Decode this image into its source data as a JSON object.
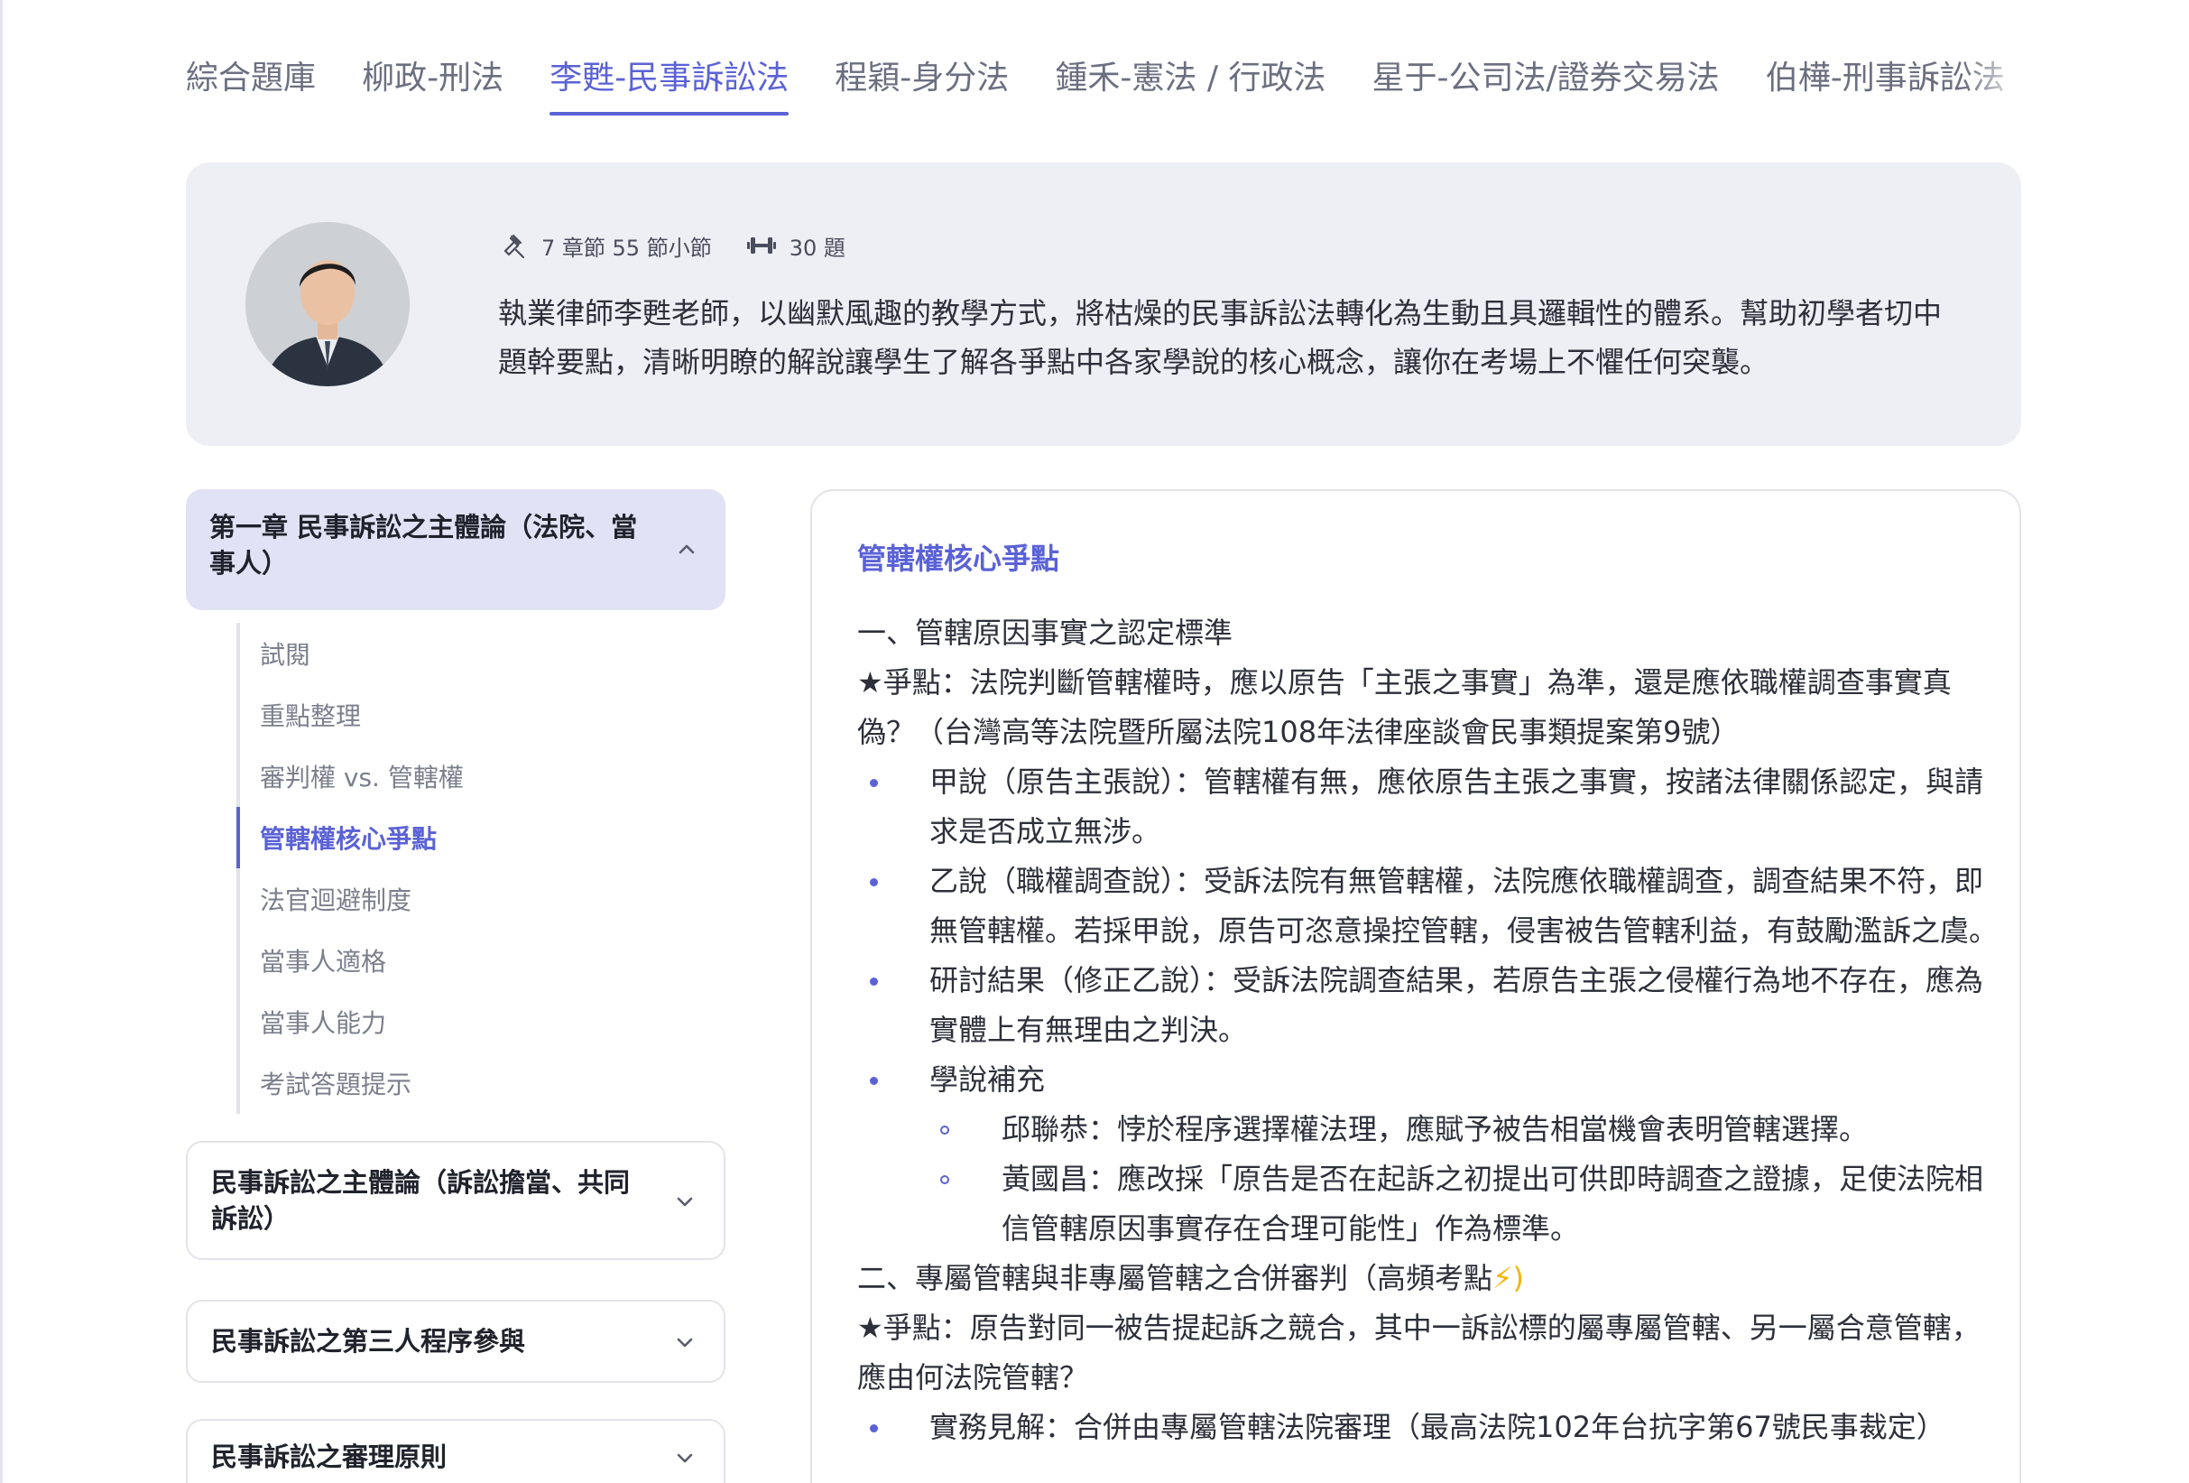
{
  "tabs": [
    {
      "label": "綜合題庫"
    },
    {
      "label": "柳政-刑法"
    },
    {
      "label": "李甦-民事訴訟法"
    },
    {
      "label": "程穎-身分法"
    },
    {
      "label": "鍾禾-憲法 / 行政法"
    },
    {
      "label": "星于-公司法/證券交易法"
    },
    {
      "label": "伯樺-刑事訴訟法"
    }
  ],
  "active_tab_index": 2,
  "course": {
    "chapters_text": "7 章節 55 節小節",
    "questions_text": "30 題",
    "description": "執業律師李甦老師，以幽默風趣的教學方式，將枯燥的民事訴訟法轉化為生動且具邏輯性的體系。幫助初學者切中題幹要點，清晰明瞭的解說讓學生了解各爭點中各家學說的核心概念，讓你在考場上不懼任何突襲。",
    "icons": {
      "chapters": "gavel-icon",
      "questions": "dumbbell-icon"
    }
  },
  "sidebar": {
    "open_chapter": {
      "title": "第一章 民事訴訟之主體論（法院、當事人）",
      "sections": [
        {
          "label": "試閱"
        },
        {
          "label": "重點整理"
        },
        {
          "label": "審判權 vs. 管轄權"
        },
        {
          "label": "管轄權核心爭點"
        },
        {
          "label": "法官迴避制度"
        },
        {
          "label": "當事人適格"
        },
        {
          "label": "當事人能力"
        },
        {
          "label": "考試答題提示"
        }
      ],
      "active_section_index": 3
    },
    "chapters": [
      {
        "title": "民事訴訟之主體論（訴訟擔當、共同訴訟）"
      },
      {
        "title": "民事訴訟之第三人程序參與"
      },
      {
        "title": "民事訴訟之審理原則"
      }
    ]
  },
  "content": {
    "title": "管轄權核心爭點",
    "blocks": [
      {
        "type": "p",
        "text": "一、管轄原因事實之認定標準"
      },
      {
        "type": "p",
        "text": "★爭點：法院判斷管轄權時，應以原告「主張之事實」為準，還是應依職權調查事實真偽？（台灣高等法院暨所屬法院108年法律座談會民事類提案第9號）"
      },
      {
        "type": "b",
        "text": " 甲說（原告主張說）：管轄權有無，應依原告主張之事實，按諸法律關係認定，與請求是否成立無涉。"
      },
      {
        "type": "b",
        "text": "乙說（職權調查說）：受訴法院有無管轄權，法院應依職權調查，調查結果不符，即無管轄權。若採甲說，原告可恣意操控管轄，侵害被告管轄利益，有鼓勵濫訴之虞。"
      },
      {
        "type": "b",
        "text": "研討結果（修正乙說）：受訴法院調查結果，若原告主張之侵權行為地不存在，應為實體上有無理由之判決。"
      },
      {
        "type": "b",
        "text": "學說補充"
      },
      {
        "type": "b2",
        "text": "邱聯恭：悖於程序選擇權法理，應賦予被告相當機會表明管轄選擇。"
      },
      {
        "type": "b2",
        "text": "黃國昌：應改採「原告是否在起訴之初提出可供即時調查之證據，足使法院相信管轄原因事實存在合理可能性」作為標準。"
      },
      {
        "type": "p",
        "text": "二、專屬管轄與非專屬管轄之合併審判（高頻考點"
      },
      {
        "type": "p",
        "text": "★爭點：原告對同一被告提起訴之競合，其中一訴訟標的屬專屬管轄、另一屬合意管轄，應由何法院管轄？"
      },
      {
        "type": "b",
        "text": "實務見解：合併由專屬管轄法院審理（最高法院102年台抗字第67號民事裁定）"
      }
    ],
    "highlight_suffix": "⚡)",
    "accent_color": "#5b62d6"
  }
}
